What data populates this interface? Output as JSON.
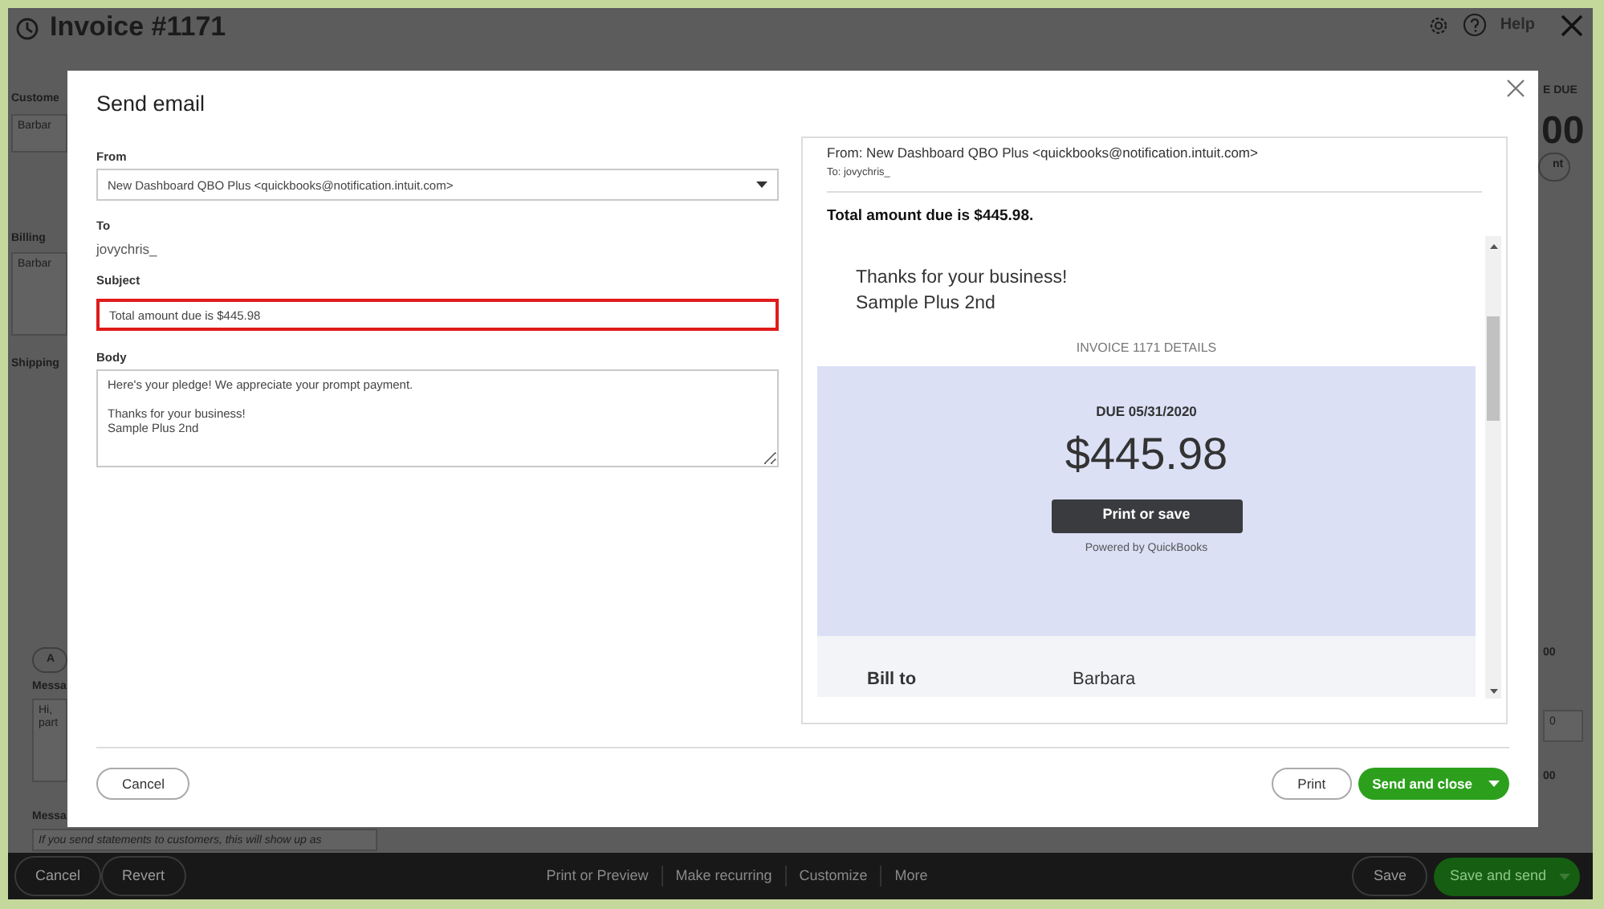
{
  "header": {
    "title": "Invoice #1171",
    "help_label": "Help"
  },
  "background_fragments": [
    {
      "kind": "label",
      "text": "E DUE"
    },
    {
      "kind": "label",
      "text": "Custome"
    },
    {
      "kind": "amount",
      "text": "00"
    },
    {
      "kind": "field",
      "text": "Barbar"
    },
    {
      "kind": "button",
      "text": "nt"
    },
    {
      "kind": "label",
      "text": "Billing"
    },
    {
      "kind": "area",
      "text": "Barbar"
    },
    {
      "kind": "label",
      "text": "Shipping"
    },
    {
      "kind": "label",
      "text": "00"
    },
    {
      "kind": "button",
      "text": "A"
    },
    {
      "kind": "label",
      "text": "Messa"
    },
    {
      "kind": "area",
      "text": "Hi,\npart"
    },
    {
      "kind": "field",
      "text": "0"
    },
    {
      "kind": "label",
      "text": "00"
    },
    {
      "kind": "label",
      "text": "Messa"
    },
    {
      "kind": "field",
      "text": "If you send statements to customers, this will show up as"
    }
  ],
  "dialog": {
    "title": "Send email",
    "form": {
      "from": {
        "label": "From",
        "value": "New Dashboard QBO Plus <quickbooks@notification.intuit.com>"
      },
      "to": {
        "label": "To",
        "value": "jovychris_"
      },
      "subject": {
        "label": "Subject",
        "value": "Total amount due is $445.98",
        "highlighted": true
      },
      "body": {
        "label": "Body",
        "value": "Here's your pledge! We appreciate your prompt payment.\n\nThanks for your business!\nSample Plus 2nd"
      }
    },
    "preview": {
      "from": "From: New Dashboard QBO Plus <quickbooks@notification.intuit.com>",
      "to": "To: jovychris_",
      "subject": "Total amount due is $445.98.",
      "message_lines": [
        "Thanks for your business!",
        "Sample Plus 2nd"
      ],
      "details_heading": "INVOICE 1171 DETAILS",
      "due_date": "DUE 05/31/2020",
      "amount": "$445.98",
      "action_button": "Print or save",
      "powered_by": "Powered by QuickBooks",
      "bill_to_label": "Bill to",
      "bill_to_value": "Barbara"
    },
    "cancel_button": "Cancel",
    "print_button": "Print",
    "send_button": "Send and close"
  },
  "bottom_bar": {
    "left_buttons": [
      "Cancel",
      "Revert"
    ],
    "links": [
      "Print or Preview",
      "Make recurring",
      "Customize",
      "More"
    ],
    "save_button": "Save",
    "save_send_button": "Save and send"
  }
}
